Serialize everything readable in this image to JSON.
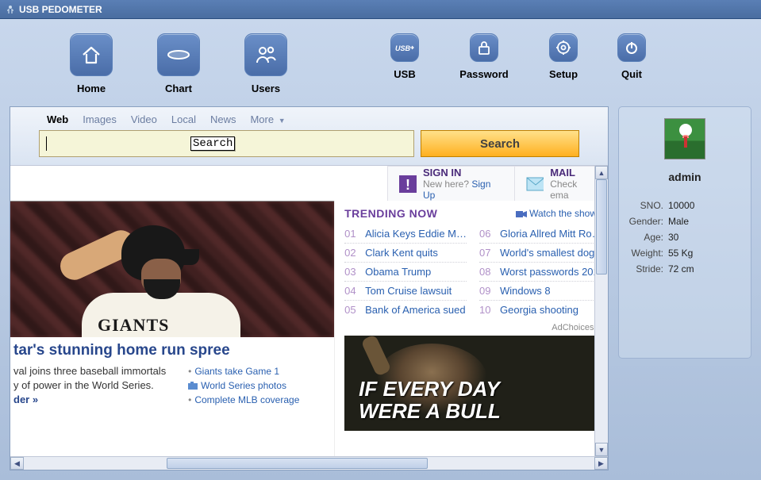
{
  "window": {
    "title": "USB PEDOMETER"
  },
  "toolbar": {
    "home": "Home",
    "chart": "Chart",
    "users": "Users",
    "usb": "USB",
    "password": "Password",
    "setup": "Setup",
    "quit": "Quit"
  },
  "browser": {
    "tabs": {
      "web": "Web",
      "images": "Images",
      "video": "Video",
      "local": "Local",
      "news": "News",
      "more": "More"
    },
    "search_placeholder": "Search",
    "search_button": "Search",
    "signin": {
      "title": "SIGN IN",
      "sub_prefix": "New here? ",
      "sub_link": "Sign Up"
    },
    "mail": {
      "title": "MAIL",
      "sub": "Check ema"
    },
    "trending_title": "TRENDING NOW",
    "watch": "Watch the show »",
    "trending_left": [
      {
        "n": "01",
        "t": "Alicia Keys Eddie M…"
      },
      {
        "n": "02",
        "t": "Clark Kent quits"
      },
      {
        "n": "03",
        "t": "Obama Trump"
      },
      {
        "n": "04",
        "t": "Tom Cruise lawsuit"
      },
      {
        "n": "05",
        "t": "Bank of America sued"
      }
    ],
    "trending_right": [
      {
        "n": "06",
        "t": "Gloria Allred Mitt Ro…"
      },
      {
        "n": "07",
        "t": "World's smallest dog"
      },
      {
        "n": "08",
        "t": "Worst passwords 2012"
      },
      {
        "n": "09",
        "t": "Windows 8"
      },
      {
        "n": "10",
        "t": "Georgia shooting"
      }
    ],
    "adchoices": "AdChoices",
    "ad_line1": "IF EVERY DAY",
    "ad_line2": "WERE A BULL",
    "hero": {
      "jersey": "GIANTS",
      "headline": "tar's stunning home run spree",
      "sub1": "val joins three baseball immortals",
      "sub2": "y of power in the World Series.",
      "more": "der »",
      "links": [
        {
          "icon": "bullet",
          "t": "Giants take Game 1"
        },
        {
          "icon": "photo",
          "t": "World Series photos"
        },
        {
          "icon": "bullet",
          "t": "Complete MLB coverage"
        }
      ]
    }
  },
  "profile": {
    "name": "admin",
    "rows": [
      {
        "k": "SNO.",
        "v": "10000"
      },
      {
        "k": "Gender:",
        "v": "Male"
      },
      {
        "k": "Age:",
        "v": "30"
      },
      {
        "k": "Weight:",
        "v": "55 Kg"
      },
      {
        "k": "Stride:",
        "v": "72 cm"
      }
    ]
  }
}
